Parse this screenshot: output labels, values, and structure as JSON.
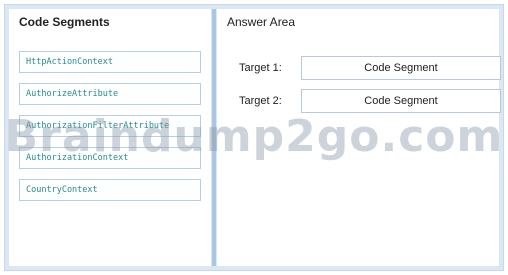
{
  "code_segments_panel": {
    "title": "Code Segments",
    "items": [
      "HttpActionContext",
      "AuthorizeAttribute",
      "AuthorizationFilterAttribute",
      "AuthorizationContext",
      "CountryContext"
    ]
  },
  "answer_area": {
    "title": "Answer Area",
    "targets": [
      {
        "label": "Target 1:",
        "slot_text": "Code Segment"
      },
      {
        "label": "Target 2:",
        "slot_text": "Code Segment"
      }
    ]
  },
  "watermark": "Braindump2go.com",
  "colors": {
    "frame_background": "#dbe7f3",
    "divider": "#a9c6e2",
    "segment_border": "#b9cde0",
    "code_text": "#2a8c8c"
  }
}
